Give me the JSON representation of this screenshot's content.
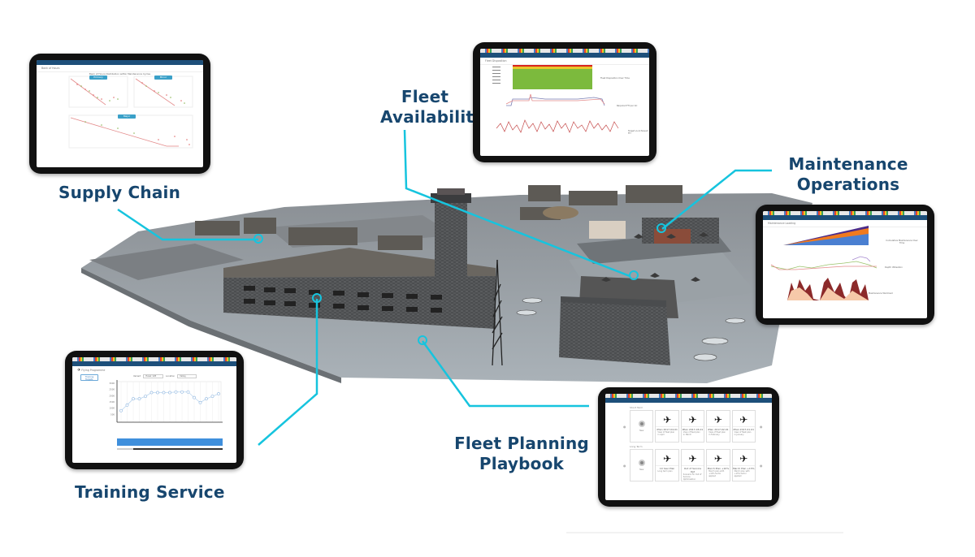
{
  "accent_color": "#16c4de",
  "label_color": "#17466e",
  "labels": {
    "supply_chain": "Supply Chain",
    "fleet_availability_line1": "Fleet",
    "fleet_availability_line2": "Availability",
    "maintenance_line1": "Maintenance",
    "maintenance_line2": "Operations",
    "fleet_planning_line1": "Fleet Planning",
    "fleet_planning_line2": "Playbook",
    "training_service": "Training Service"
  },
  "tablets": {
    "supply_chain": {
      "page_title": "Bank of Hours",
      "chart_title": "Bank of Hours Distribution within Maintenance Cycles",
      "panels": [
        "Primary",
        "Minor",
        "Major"
      ],
      "xlabel": "Months since last maintenance",
      "ylabel": "Bank of hours"
    },
    "fleet_availability": {
      "page_title": "Fleet Disposition",
      "sections": [
        "Fleet Disposition Over Time",
        "Required FH per AC",
        "Target vs Achieved FH"
      ]
    },
    "maintenance": {
      "page_title": "Maintenance Loading",
      "sections": [
        "Cumulative Maintenance Over Time",
        "Depth Utilisation",
        "Maintenance Workload"
      ]
    },
    "training": {
      "page_title": "Flying Programme",
      "button": "Training Targets",
      "filter1_label": "Variant",
      "filter1_value": "Hawk 128",
      "filter2_label": "Location",
      "filter2_value": "Valley",
      "series": [
        800,
        1250,
        1750,
        1750,
        1950,
        2250,
        2250,
        2250,
        2250,
        2300,
        2300,
        2300,
        1850,
        1450,
        1750,
        1950,
        2150
      ],
      "y_ticks": [
        "3000",
        "2500",
        "2000",
        "1500",
        "1000",
        "500"
      ]
    },
    "playbook": {
      "short_term_label": "Short Term",
      "long_term_label": "Long Term",
      "new_label": "New",
      "short_term": [
        {
          "name": "iPlan 2017-04-01",
          "desc": "View of fleet plan in April"
        },
        {
          "name": "iPlan 2017-03-01",
          "desc": "View of fleet plan in March"
        },
        {
          "name": "iPlan 2017-02-01",
          "desc": "View of fleet plan in February"
        },
        {
          "name": "iPlan 2017-01-01",
          "desc": "View of fleet plan in January"
        }
      ],
      "long_term": [
        {
          "name": "10 Year Plan",
          "desc": "Long term plan"
        },
        {
          "name": "Out of Service Opt",
          "desc": "Scenario for Out of Service Optimisation"
        },
        {
          "name": "March Plan +10%",
          "desc": "March plan with +10% factor applied"
        },
        {
          "name": "March Plan +15%",
          "desc": "March plan with +15% factor applied"
        }
      ]
    }
  }
}
